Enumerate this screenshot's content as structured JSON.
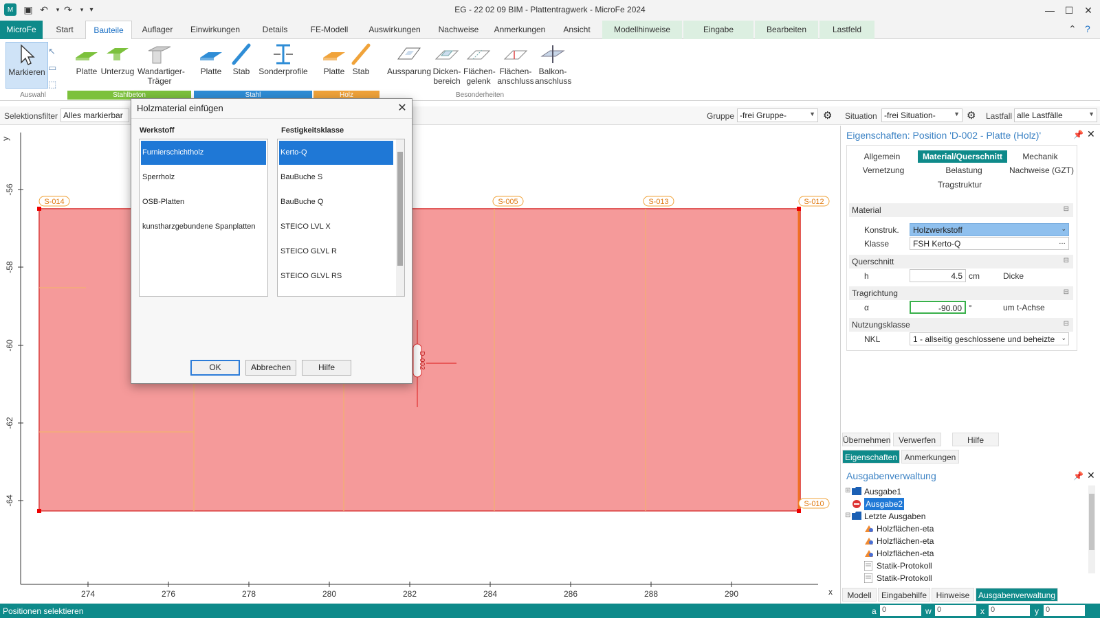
{
  "window": {
    "title": "EG - 22 02 09 BIM - Plattentragwerk - MicroFe 2024"
  },
  "ribbon_tabs": [
    {
      "label": "MicroFe",
      "app": true
    },
    {
      "label": "Start"
    },
    {
      "label": "Bauteile",
      "active": true
    },
    {
      "label": "Auflager"
    },
    {
      "label": "Einwirkungen"
    },
    {
      "label": "Details"
    },
    {
      "label": "FE-Modell"
    },
    {
      "label": "Auswirkungen"
    },
    {
      "label": "Nachweise"
    },
    {
      "label": "Anmerkungen"
    },
    {
      "label": "Ansicht"
    },
    {
      "label": "Modellhinweise",
      "ctx": true
    },
    {
      "label": "Eingabe",
      "ctx": true
    },
    {
      "label": "Bearbeiten",
      "ctx": true
    },
    {
      "label": "Lastfeld",
      "ctx": true
    }
  ],
  "ribbon": {
    "buttons": [
      {
        "label": "Markieren",
        "icon": "cursor-icon"
      },
      {
        "label": "Platte",
        "icon": "plate-icon"
      },
      {
        "label": "Unterzug",
        "icon": "beam-icon"
      },
      {
        "label": "Wandartiger-\nTräger",
        "icon": "wall-beam-icon"
      },
      {
        "label": "Platte",
        "icon": "plate-icon"
      },
      {
        "label": "Stab",
        "icon": "bar-icon"
      },
      {
        "label": "Sonderprofile",
        "icon": "profile-icon"
      },
      {
        "label": "Platte",
        "icon": "plate-icon"
      },
      {
        "label": "Stab",
        "icon": "bar-icon"
      },
      {
        "label": "Aussparung",
        "icon": "opening-icon"
      },
      {
        "label": "Dicken-\nbereich",
        "icon": "thickness-icon"
      },
      {
        "label": "Flächen-\ngelenk",
        "icon": "hinge-icon"
      },
      {
        "label": "Flächen-\nanschluss",
        "icon": "connection-icon"
      },
      {
        "label": "Balkon-\nanschluss",
        "icon": "balcony-icon"
      }
    ],
    "groups": {
      "auswahl": "Auswahl",
      "stahlbeton": "Stahlbeton",
      "stahl": "Stahl",
      "holz": "Holz",
      "besonderheiten": "Besonderheiten"
    },
    "colors": {
      "stahlbeton": "#7cc13c",
      "stahl": "#2f8dd6",
      "holz": "#f0a33a"
    }
  },
  "filterbar": {
    "selektionsfilter_label": "Selektionsfilter",
    "selektionsfilter_value": "Alles markierbar",
    "gruppe_label": "Gruppe",
    "gruppe_value": "-frei Gruppe-",
    "situation_label": "Situation",
    "situation_value": "-frei Situation-",
    "lastfall_label": "Lastfall",
    "lastfall_value": "alle Lastfälle"
  },
  "canvas": {
    "x_ticks": [
      "274",
      "276",
      "278",
      "280",
      "282",
      "284",
      "286",
      "288",
      "290"
    ],
    "y_ticks": [
      "-56",
      "-58",
      "-60",
      "-62",
      "-64"
    ],
    "x_axis_label": "x",
    "y_axis_label": "y",
    "node_labels": [
      "S-014",
      "S-005",
      "S-013",
      "S-012",
      "S-010"
    ],
    "plate_label": "D-002",
    "plate_color": "#f59a9a"
  },
  "dialog": {
    "title": "Holzmaterial einfügen",
    "werkstoff_header": "Werkstoff",
    "festigkeit_header": "Festigkeitsklasse",
    "werkstoffe": [
      "Furnierschichtholz",
      "Sperrholz",
      "OSB-Platten",
      "kunstharzgebundene Spanplatten"
    ],
    "festigkeitsklassen": [
      "Kerto-Q",
      "BauBuche S",
      "BauBuche Q",
      "STEICO LVL X",
      "STEICO GLVL R",
      "STEICO GLVL RS"
    ],
    "ok": "OK",
    "abbrechen": "Abbrechen",
    "hilfe": "Hilfe"
  },
  "properties": {
    "title": "Eigenschaften: Position 'D-002 - Platte (Holz)'",
    "tabs": [
      "Allgemein",
      "Material/Querschnitt",
      "Mechanik",
      "Vernetzung",
      "Belastung",
      "Nachweise (GZT)",
      "Tragstruktur"
    ],
    "material_head": "Material",
    "konstruk_label": "Konstruk.",
    "konstruk_value": "Holzwerkstoff",
    "klasse_label": "Klasse",
    "klasse_value": "FSH Kerto-Q",
    "querschnitt_head": "Querschnitt",
    "h_label": "h",
    "h_value": "4.5",
    "h_unit": "cm",
    "h_desc": "Dicke",
    "tragrichtung_head": "Tragrichtung",
    "alpha_label": "α",
    "alpha_value": "-90.00",
    "alpha_unit": "°",
    "alpha_desc": "um t-Achse",
    "nkl_head": "Nutzungsklasse",
    "nkl_label": "NKL",
    "nkl_value": "1 - allseitig geschlossene und beheizte",
    "buttons": [
      "Übernehmen",
      "Verwerfen",
      "Hilfe"
    ],
    "bottom_tabs": [
      "Eigenschaften",
      "Anmerkungen"
    ]
  },
  "ausgaben": {
    "title": "Ausgabenverwaltung",
    "items": [
      {
        "label": "Ausgabe1",
        "indent": 0,
        "icon": "folder-icon"
      },
      {
        "label": "Ausgabe2",
        "indent": 0,
        "icon": "no-entry-icon",
        "selected": true
      },
      {
        "label": "Letzte Ausgaben",
        "indent": 0,
        "icon": "folder-icon"
      },
      {
        "label": "Holzflächen-eta",
        "indent": 1,
        "icon": "result-icon"
      },
      {
        "label": "Holzflächen-eta",
        "indent": 1,
        "icon": "result-icon"
      },
      {
        "label": "Holzflächen-eta",
        "indent": 1,
        "icon": "result-icon"
      },
      {
        "label": "Statik-Protokoll",
        "indent": 1,
        "icon": "document-icon"
      },
      {
        "label": "Statik-Protokoll",
        "indent": 1,
        "icon": "document-icon"
      }
    ],
    "panel_tabs": [
      "Modell",
      "Eingabehilfe",
      "Hinweise",
      "Ausgabenverwaltung"
    ]
  },
  "statusbar": {
    "text": "Positionen selektieren",
    "a": "0",
    "w": "0",
    "x": "0",
    "y": "0"
  }
}
